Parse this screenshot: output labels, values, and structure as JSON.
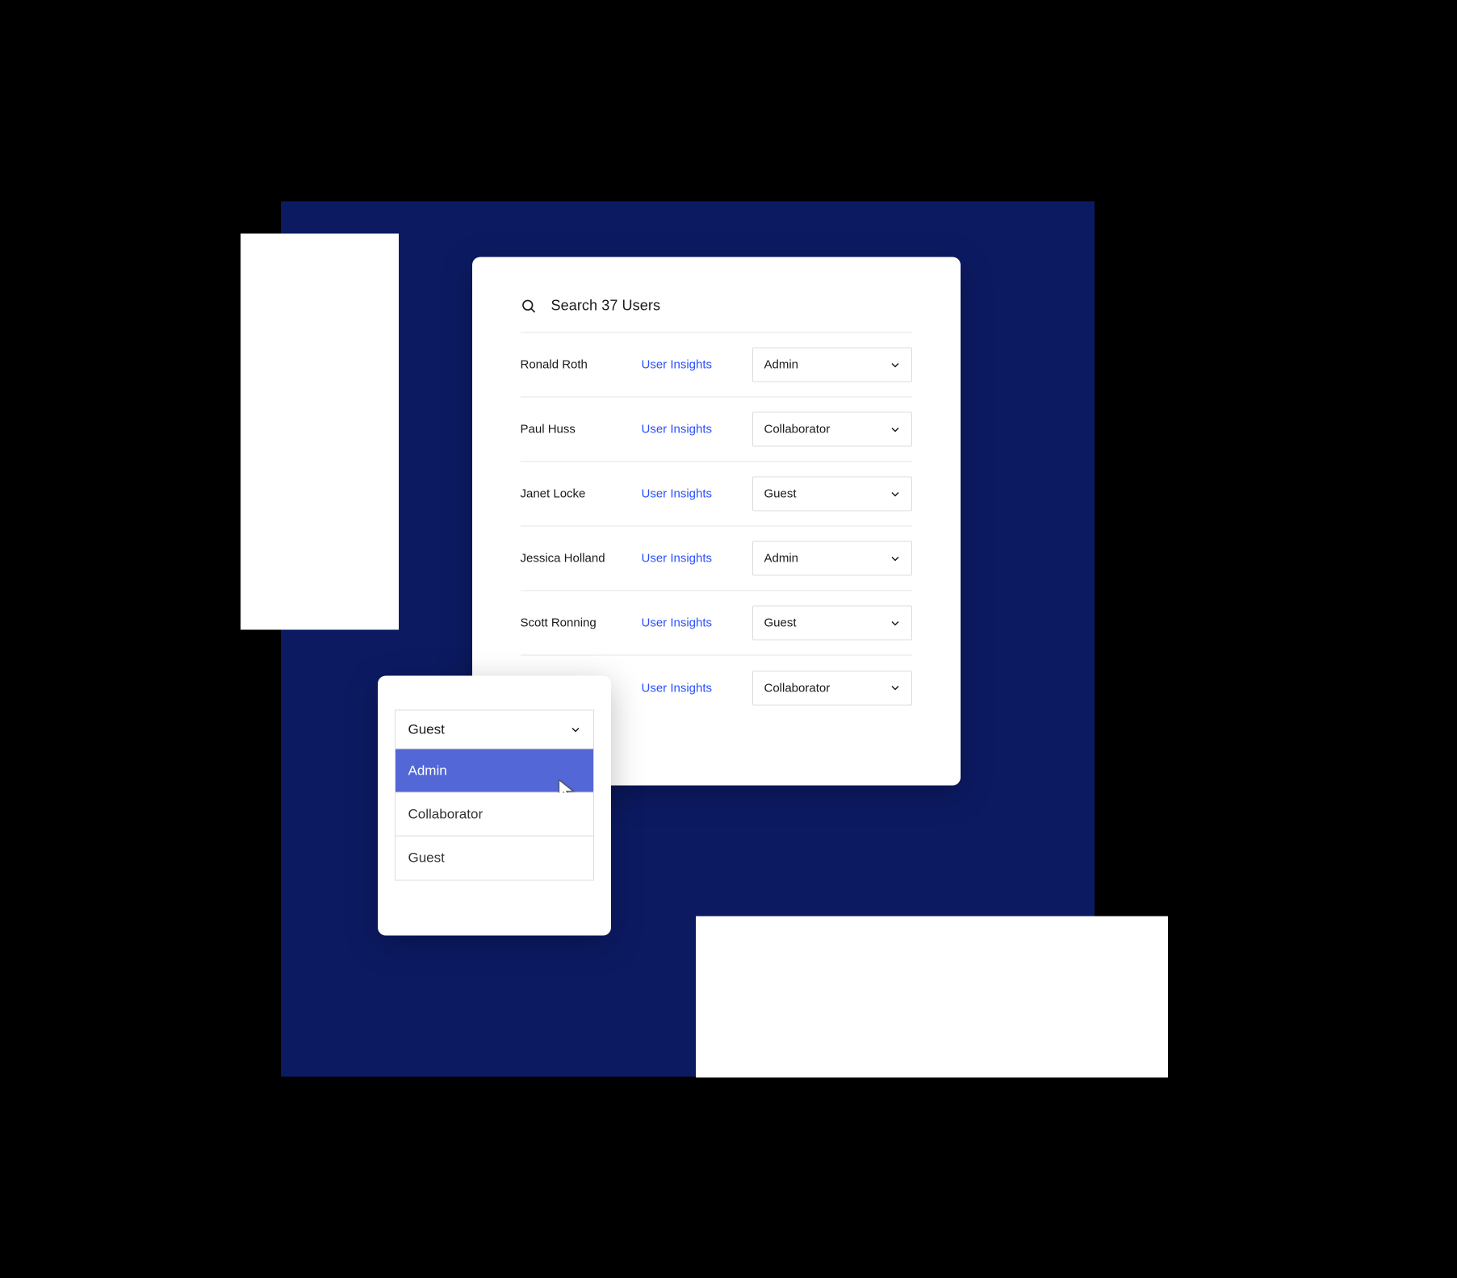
{
  "search": {
    "placeholder": "Search 37 Users"
  },
  "insightsLabel": "User Insights",
  "users": [
    {
      "name": "Ronald Roth",
      "role": "Admin"
    },
    {
      "name": "Paul Huss",
      "role": "Collaborator"
    },
    {
      "name": "Janet Locke",
      "role": "Guest"
    },
    {
      "name": "Jessica Holland",
      "role": "Admin"
    },
    {
      "name": "Scott Ronning",
      "role": "Guest"
    },
    {
      "name": "",
      "role": "Collaborator"
    }
  ],
  "dropdown": {
    "current": "Guest",
    "options": [
      "Admin",
      "Collaborator",
      "Guest"
    ],
    "selectedIndex": 0
  }
}
